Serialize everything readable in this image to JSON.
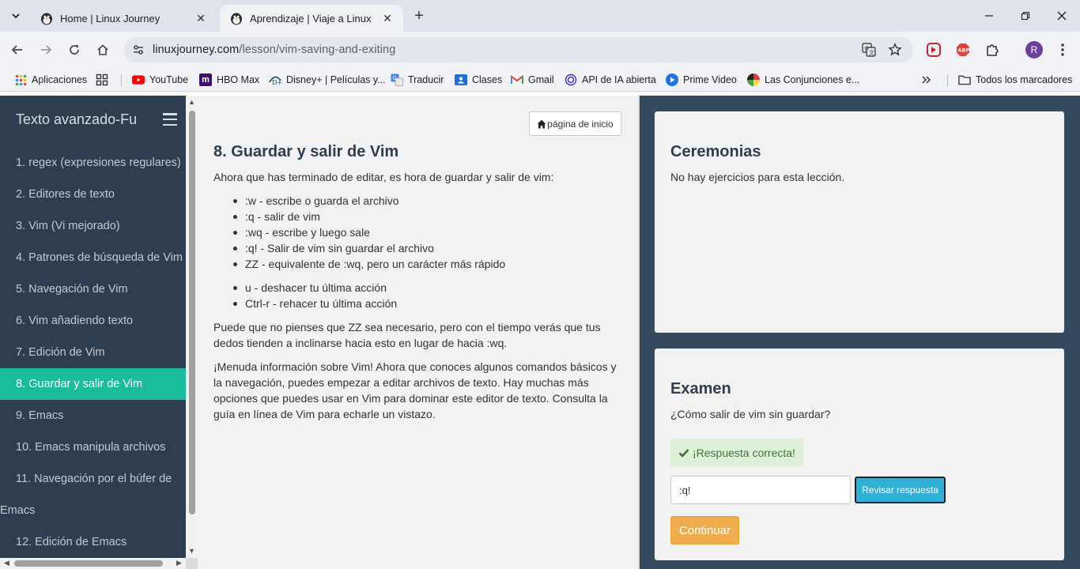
{
  "browser": {
    "tabs": [
      {
        "title": "Home | Linux Journey",
        "active": false
      },
      {
        "title": "Aprendizaje | Viaje a Linux",
        "active": true
      }
    ],
    "url_host": "linuxjourney.com",
    "url_path": "/lesson/vim-saving-and-exiting",
    "profile_initial": "R",
    "abp_label": "ABP",
    "bookmarks": [
      {
        "label": "Aplicaciones",
        "icon": "apps-grid-icon"
      },
      {
        "label": "YouTube",
        "icon": "youtube-icon"
      },
      {
        "label": "HBO Max",
        "icon": "hbo-max-icon"
      },
      {
        "label": "Disney+ | Películas y...",
        "icon": "disney-plus-icon"
      },
      {
        "label": "Traducir",
        "icon": "translate-icon"
      },
      {
        "label": "Clases",
        "icon": "classroom-icon"
      },
      {
        "label": "Gmail",
        "icon": "gmail-icon"
      },
      {
        "label": "API de IA abierta",
        "icon": "openai-icon"
      },
      {
        "label": "Prime Video",
        "icon": "prime-video-icon"
      },
      {
        "label": "Las Conjunciones e...",
        "icon": "conjunciones-icon"
      }
    ],
    "all_bookmarks_label": "Todos los marcadores",
    "hbo_glyph": "m"
  },
  "sidebar": {
    "title": "Texto avanzado-Fu",
    "lessons": [
      {
        "label": "1. regex (expresiones regulares)",
        "active": false
      },
      {
        "label": "2. Editores de texto",
        "active": false
      },
      {
        "label": "3. Vim (Vi mejorado)",
        "active": false
      },
      {
        "label": "4. Patrones de búsqueda de Vim",
        "active": false
      },
      {
        "label": "5. Navegación de Vim",
        "active": false
      },
      {
        "label": "6. Vim añadiendo texto",
        "active": false
      },
      {
        "label": "7. Edición de Vim",
        "active": false
      },
      {
        "label": "8. Guardar y salir de Vim",
        "active": true
      },
      {
        "label": "9. Emacs",
        "active": false
      },
      {
        "label": "10. Emacs manipula archivos",
        "active": false
      },
      {
        "label": "11. Navegación por el búfer de",
        "active": false
      },
      {
        "label": "Emacs",
        "active": false
      },
      {
        "label": "12. Edición de Emacs",
        "active": false
      }
    ]
  },
  "lesson": {
    "home_button": "página de inicio",
    "title": "8. Guardar y salir de Vim",
    "intro": "Ahora que has terminado de editar, es hora de guardar y salir de vim:",
    "commands": [
      ":w - escribe o guarda el archivo",
      ":q - salir de vim",
      ":wq - escribe y luego sale",
      ":q! - Salir de vim sin guardar el archivo",
      "ZZ - equivalente de :wq, pero un carácter más rápido"
    ],
    "undo_commands": [
      "u - deshacer tu última acción",
      "Ctrl-r - rehacer tu última acción"
    ],
    "para1": "Puede que no pienses que ZZ sea necesario, pero con el tiempo verás que tus dedos tienden a inclinarse hacia esto en lugar de hacia :wq.",
    "para2": "¡Menuda información sobre Vim! Ahora que conoces algunos comandos básicos y la navegación, puedes empezar a editar archivos de texto. Hay muchas más opciones que puedes usar en Vim para dominar este editor de texto. Consulta la guía en línea de Vim para echarle un vistazo."
  },
  "exercises": {
    "title": "Ceremonias",
    "text": "No hay ejercicios para esta lección."
  },
  "quiz": {
    "title": "Examen",
    "question": "¿Cómo salir de vim sin guardar?",
    "feedback": "¡Respuesta correcta!",
    "answer_value": ":q!",
    "check_button": "Revisar respuesta",
    "continue_button": "Continuar"
  },
  "colors": {
    "sidebar_bg": "#2d3e50",
    "active_lesson": "#1abc9c",
    "right_bg": "#34495e",
    "success_bg": "#dff0d8",
    "check_btn": "#31b0d5",
    "continue_btn": "#f0ad4e"
  }
}
